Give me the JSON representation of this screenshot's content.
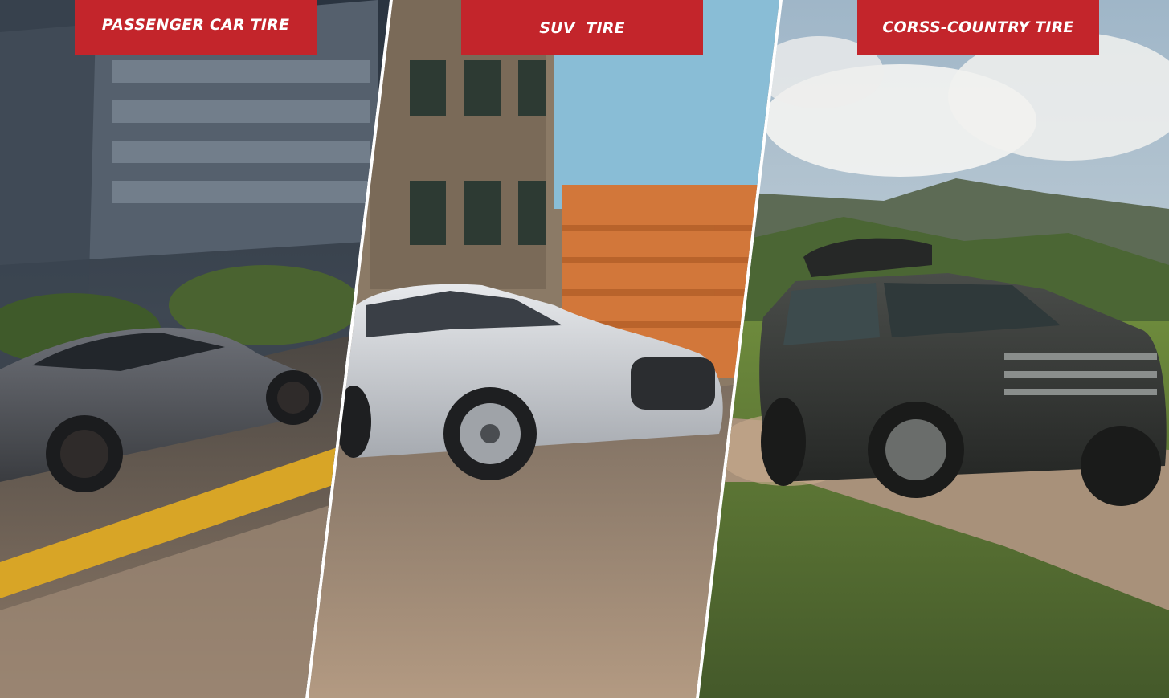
{
  "categories": [
    {
      "label": "PASSENGER CAR TIRE",
      "scene": "passenger-car-city-scene"
    },
    {
      "label": "SUV  TIRE",
      "scene": "suv-street-scene"
    },
    {
      "label": "CORSS-COUNTRY TIRE",
      "scene": "offroad-mountain-scene"
    }
  ],
  "colors": {
    "label_background": "#c3252b",
    "label_text": "#ffffff"
  }
}
